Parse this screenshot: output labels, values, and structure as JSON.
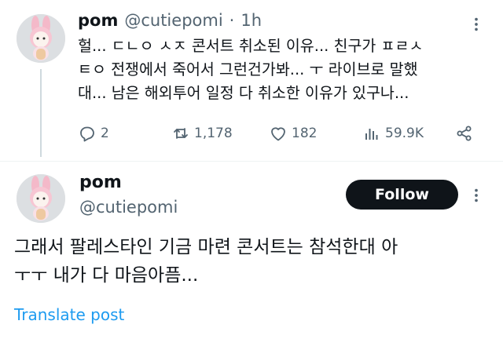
{
  "tweet1": {
    "name": "pom",
    "handle": "@cutiepomi",
    "separator": "·",
    "time": "1h",
    "text_lines": [
      "헐... ㄷㄴㅇ ㅅㅈ 콘서트 취소된 이유... 친구가 ㅍㄹㅅ",
      "ㅌㅇ 전쟁에서 죽어서 그런건가봐... ㅜ 라이브로 말했",
      "대... 남은 해외투어 일정 다 취소한 이유가 있구나..."
    ],
    "actions": {
      "reply": {
        "icon": "reply-icon",
        "count": "2"
      },
      "repost": {
        "icon": "repost-icon",
        "count": "1,178"
      },
      "like": {
        "icon": "heart-icon",
        "count": "182"
      },
      "views": {
        "icon": "views-icon",
        "count": "59.9K"
      },
      "share": {
        "icon": "share-icon"
      }
    }
  },
  "tweet2": {
    "name": "pom",
    "handle": "@cutiepomi",
    "follow_label": "Follow",
    "text_lines": [
      "그래서 팔레스타인 기금 마련 콘서트는 참석한대 아",
      "ㅜㅜ 내가 다 마음아픔..."
    ],
    "translate_label": "Translate post"
  },
  "colors": {
    "text": "#0f1419",
    "secondary": "#536471",
    "link": "#1d9bf0",
    "follow_bg": "#0f1419",
    "follow_text": "#ffffff"
  }
}
